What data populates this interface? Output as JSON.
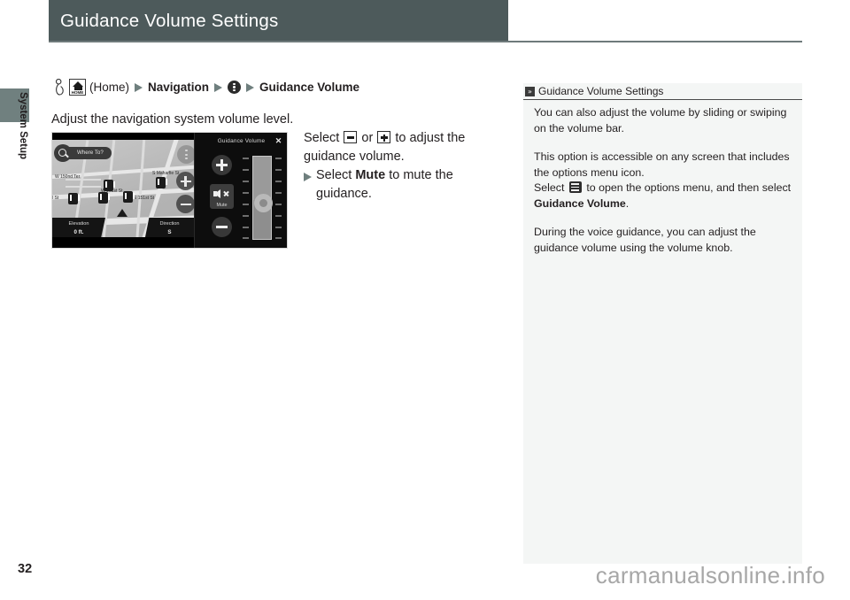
{
  "header": {
    "title": "Guidance Volume Settings"
  },
  "section_tab": {
    "label": "System Setup"
  },
  "breadcrumb": {
    "hand_icon": "hand-press-icon",
    "home_icon_label": "HOME",
    "home_text": "(Home)",
    "item_navigation": "Navigation",
    "options_menu_icon": "options-menu-icon",
    "item_guidance_volume": "Guidance Volume"
  },
  "intro": {
    "text": "Adjust the navigation system volume level."
  },
  "nav_screenshot": {
    "search_placeholder": "Where To?",
    "map_labels": [
      "W 150nd Ter",
      "S Maharfie St",
      "W 151st St",
      "E 151st St",
      "l St"
    ],
    "elevation_label": "Elevation",
    "elevation_value": "0 ft.",
    "direction_label": "Direction",
    "direction_value": "S",
    "panel_title": "Guidance Volume",
    "close_label": "✕",
    "mute_label": "Mute",
    "plus_icon": "plus-icon",
    "minus_icon": "minus-icon",
    "volume_percent": 47
  },
  "instructions": {
    "line1_prefix": "Select",
    "line1_mid": "or",
    "line1_suffix": "to adjust the",
    "line2": "guidance volume.",
    "bullet_prefix": "Select ",
    "bullet_bold": "Mute",
    "bullet_suffix": " to mute the guidance."
  },
  "side_note": {
    "head_icon": "»",
    "title": "Guidance Volume Settings",
    "paragraph1": "You can also adjust the volume by sliding or swiping on the volume bar.",
    "paragraph2_a": "This option is accessible on any screen that includes the options menu icon.",
    "paragraph2_b_prefix": "Select ",
    "paragraph2_b_mid": " to open the options menu, and then select ",
    "paragraph2_b_bold": "Guidance Volume",
    "paragraph2_b_suffix": ".",
    "paragraph3": "During the voice guidance, you can adjust the guidance volume using the volume knob."
  },
  "footer": {
    "page_number": "32",
    "watermark": "carmanualsonline.info"
  },
  "colors": {
    "header_bg": "#4d5a5b",
    "tab_bg": "#70807f",
    "arrow_green": "#6f7f7e",
    "note_bg": "#f4f6f5",
    "watermark": "#a7a7a7"
  }
}
